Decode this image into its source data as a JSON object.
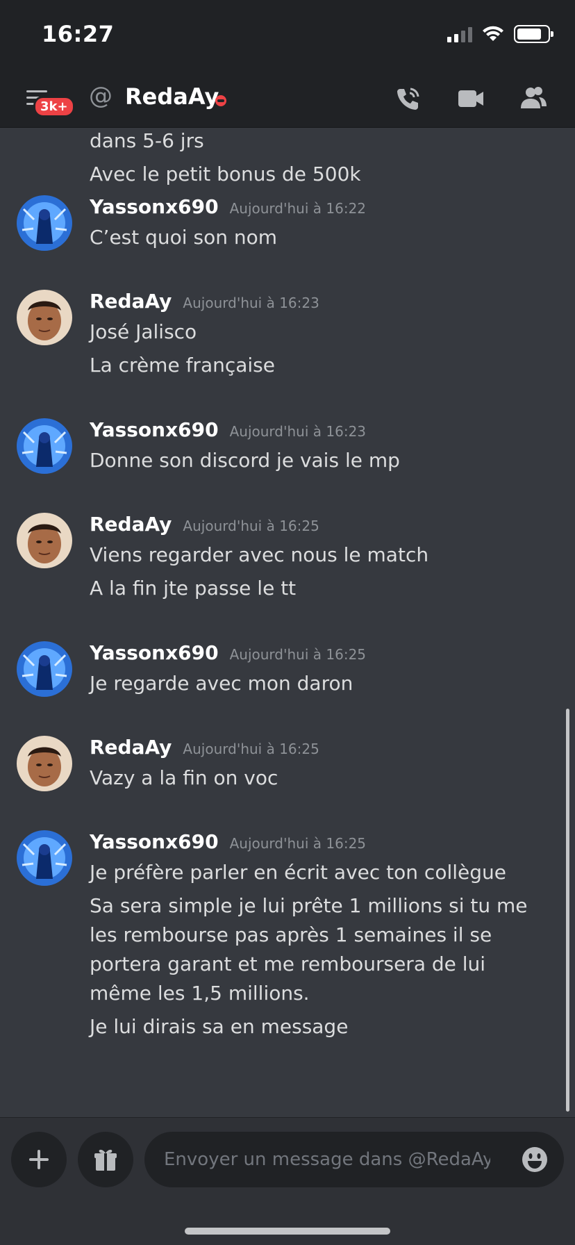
{
  "status_bar": {
    "time": "16:27"
  },
  "header": {
    "badge": "3k+",
    "at_symbol": "@",
    "title": "RedaAy"
  },
  "messages": {
    "continued_lines": [
      "dans 5-6 jrs",
      "Avec le petit bonus de 500k"
    ],
    "groups": [
      {
        "author": "Yassonx690",
        "timestamp": "Aujourd'hui à 16:22",
        "avatar": "blue-avatar",
        "lines": [
          "C’est quoi son nom"
        ]
      },
      {
        "author": "RedaAy",
        "timestamp": "Aujourd'hui à 16:23",
        "avatar": "face-avatar",
        "lines": [
          "José Jalisco",
          "La crème française"
        ]
      },
      {
        "author": "Yassonx690",
        "timestamp": "Aujourd'hui à 16:23",
        "avatar": "blue-avatar",
        "lines": [
          "Donne son discord je vais le mp"
        ]
      },
      {
        "author": "RedaAy",
        "timestamp": "Aujourd'hui à 16:25",
        "avatar": "face-avatar",
        "lines": [
          "Viens regarder avec nous le match",
          "A la fin jte passe le tt"
        ]
      },
      {
        "author": "Yassonx690",
        "timestamp": "Aujourd'hui à 16:25",
        "avatar": "blue-avatar",
        "lines": [
          "Je regarde avec mon daron"
        ]
      },
      {
        "author": "RedaAy",
        "timestamp": "Aujourd'hui à 16:25",
        "avatar": "face-avatar",
        "lines": [
          "Vazy a la fin on voc"
        ]
      },
      {
        "author": "Yassonx690",
        "timestamp": "Aujourd'hui à 16:25",
        "avatar": "blue-avatar",
        "lines": [
          "Je préfère parler en écrit avec ton collègue",
          "Sa sera simple je lui prête 1 millions si tu me les rembourse pas après 1 semaines il se portera garant et me remboursera de lui même les 1,5 millions.",
          "Je lui dirais sa en message"
        ]
      }
    ]
  },
  "composer": {
    "placeholder": "Envoyer un message dans @RedaAy"
  },
  "colors": {
    "background": "#36393f",
    "bar": "#202225",
    "composer": "#2f3136",
    "badge": "#ed4245",
    "muted": "#8e9297"
  }
}
